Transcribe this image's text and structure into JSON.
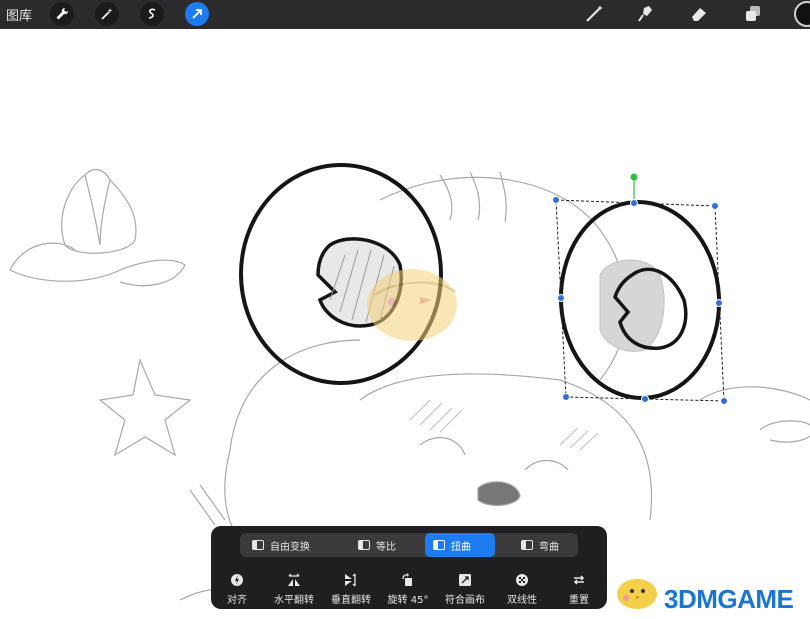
{
  "topbar": {
    "gallery_label": "图库",
    "left_tools": [
      {
        "icon": "wrench-icon"
      },
      {
        "icon": "magic-wand-icon"
      },
      {
        "icon": "selection-s-icon"
      },
      {
        "icon": "transform-arrow-icon",
        "active": true
      }
    ],
    "right_tools": [
      {
        "icon": "brush-icon"
      },
      {
        "icon": "smudge-icon"
      },
      {
        "icon": "eraser-icon"
      },
      {
        "icon": "layers-icon"
      }
    ],
    "color": "#111111"
  },
  "transform_panel": {
    "modes": [
      {
        "label": "自由变换",
        "active": false
      },
      {
        "label": "等比",
        "active": false
      },
      {
        "label": "扭曲",
        "active": true
      },
      {
        "label": "弯曲",
        "active": false
      }
    ],
    "actions": [
      {
        "label": "对齐",
        "icon": "snap-icon"
      },
      {
        "label": "水平翻转",
        "icon": "flip-horizontal-icon"
      },
      {
        "label": "垂直翻转",
        "icon": "flip-vertical-icon"
      },
      {
        "label": "旋转 45°",
        "icon": "rotate-icon"
      },
      {
        "label": "符合画布",
        "icon": "fit-canvas-icon"
      },
      {
        "label": "双线性",
        "icon": "bilinear-icon"
      },
      {
        "label": "重置",
        "icon": "reset-icon"
      }
    ]
  },
  "watermark": {
    "text": "3DMGAME",
    "logo": "3dmgame-chick-logo"
  },
  "accent_color": "#1d7cf2"
}
